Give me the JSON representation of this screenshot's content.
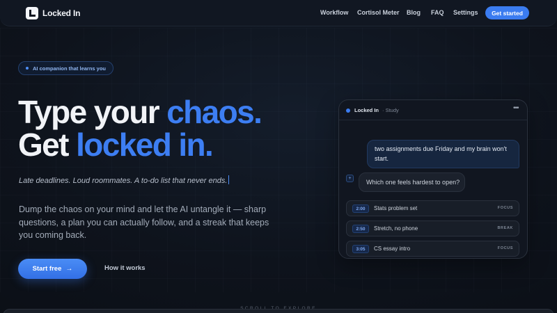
{
  "nav": {
    "logo_text": "Locked In",
    "links": [
      "Workflow",
      "Cortisol Meter",
      "Blog",
      "FAQ",
      "Settings"
    ],
    "cta": "Get started"
  },
  "hero": {
    "badge": "AI companion that learns you",
    "headline_line1_plain": "Type your ",
    "headline_line1_accent": "chaos.",
    "headline_line2_plain": "Get ",
    "headline_line2_accent": "locked in.",
    "typed_line": "Late deadlines. Loud roommates. A to-do list that never ends.",
    "description": "Dump the chaos on your mind and let the AI untangle it — sharp questions, a plan you can actually follow, and a streak that keeps you coming back.",
    "primary_button": "Start free",
    "primary_button_icon": "arrow-right-icon",
    "secondary_button": "How it works"
  },
  "chat_card": {
    "title": "Locked In",
    "subtitle": "· Study",
    "more_icon": "ellipsis-icon",
    "user_message": "two assignments due Friday and my brain won't start.",
    "ai_icon_glyph": "+",
    "ai_message": "Which one feels hardest to open?",
    "tasks": [
      {
        "time": "2:00",
        "label": "Stats problem set",
        "tag": "FOCUS"
      },
      {
        "time": "2:50",
        "label": "Stretch, no phone",
        "tag": "BREAK"
      },
      {
        "time": "3:05",
        "label": "CS essay intro",
        "tag": "FOCUS"
      }
    ]
  },
  "scroll_hint": "SCROLL TO EXPLORE",
  "colors": {
    "accent": "#3b7cf0",
    "background": "#0e131c",
    "card": "#111620"
  }
}
